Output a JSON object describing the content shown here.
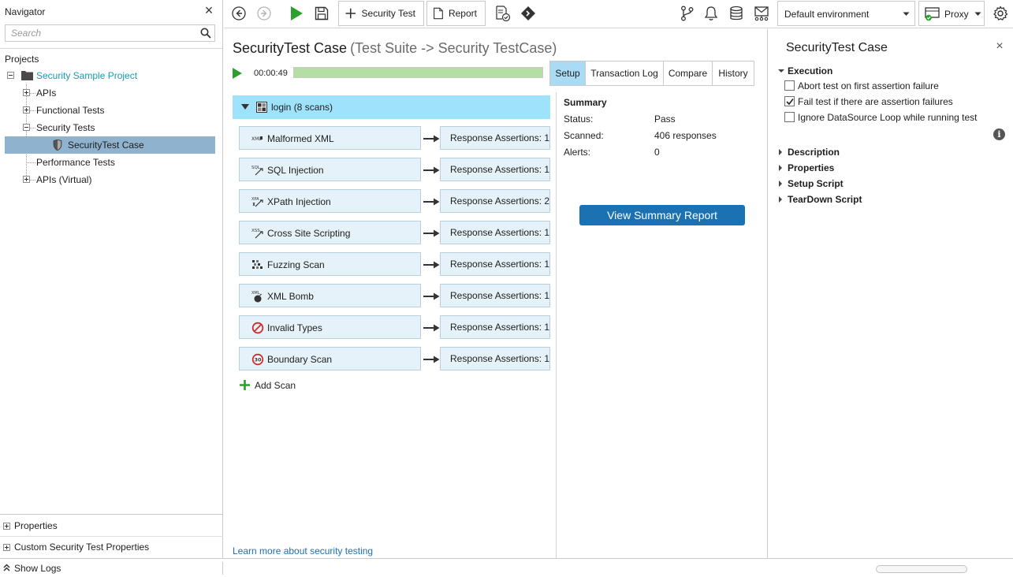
{
  "navigator": {
    "title": "Navigator",
    "search_placeholder": "Search",
    "projects_label": "Projects",
    "tree": [
      {
        "label": "Security Sample Project",
        "level": 0,
        "expanded": true,
        "kind": "project"
      },
      {
        "label": "APIs",
        "level": 1,
        "expanded": false
      },
      {
        "label": "Functional Tests",
        "level": 1,
        "expanded": false
      },
      {
        "label": "Security Tests",
        "level": 1,
        "expanded": true
      },
      {
        "label": "SecurityTest Case",
        "level": 2,
        "selected": true
      },
      {
        "label": "Performance Tests",
        "level": 1
      },
      {
        "label": "APIs (Virtual)",
        "level": 1,
        "expanded": false
      }
    ],
    "bottom": {
      "properties": "Properties",
      "custom_properties": "Custom Security Test Properties"
    }
  },
  "statusbar": {
    "show_logs": "Show Logs"
  },
  "toolbar": {
    "security_test_label": "Security Test",
    "report_label": "Report",
    "environment": "Default environment",
    "proxy_label": "Proxy"
  },
  "main": {
    "title": "SecurityTest Case",
    "subtitle": "(Test Suite -> Security TestCase)",
    "elapsed": "00:00:49",
    "progress": 1.0,
    "tabs": [
      "Setup",
      "Transaction Log",
      "Compare",
      "History"
    ],
    "active_tab": "Setup",
    "group": {
      "label": "login (8 scans)"
    },
    "scans": [
      {
        "name": "Malformed XML",
        "assertion": "Response Assertions: 1",
        "icon": "malformed-xml-icon"
      },
      {
        "name": "SQL Injection",
        "assertion": "Response Assertions: 1",
        "icon": "sql-injection-icon"
      },
      {
        "name": "XPath Injection",
        "assertion": "Response Assertions: 2",
        "icon": "xpath-injection-icon"
      },
      {
        "name": "Cross Site Scripting",
        "assertion": "Response Assertions: 1",
        "icon": "xss-icon"
      },
      {
        "name": "Fuzzing Scan",
        "assertion": "Response Assertions: 1",
        "icon": "fuzzing-icon"
      },
      {
        "name": "XML Bomb",
        "assertion": "Response Assertions: 1",
        "icon": "xml-bomb-icon"
      },
      {
        "name": "Invalid Types",
        "assertion": "Response Assertions: 1",
        "icon": "invalid-types-icon"
      },
      {
        "name": "Boundary Scan",
        "assertion": "Response Assertions: 1",
        "icon": "boundary-scan-icon"
      }
    ],
    "add_scan": "Add Scan",
    "learn_more": "Learn more about security testing",
    "summary": {
      "title": "Summary",
      "rows": [
        {
          "label": "Status:",
          "value": "Pass"
        },
        {
          "label": "Scanned:",
          "value": "406 responses"
        },
        {
          "label": "Alerts:",
          "value": "0"
        }
      ],
      "button": "View Summary Report"
    }
  },
  "right_panel": {
    "title": "SecurityTest Case",
    "execution": {
      "label": "Execution",
      "options": [
        {
          "label": "Abort test on first assertion failure",
          "checked": false
        },
        {
          "label": "Fail test if there are assertion failures",
          "checked": true
        },
        {
          "label": "Ignore DataSource Loop while running test",
          "checked": false
        }
      ]
    },
    "sections": [
      "Description",
      "Properties",
      "Setup Script",
      "TearDown Script"
    ],
    "info_glyph": "i"
  },
  "colors": {
    "accent": "#1a72b3",
    "tab_active": "#a9dbf4",
    "group_bg": "#9ee2fb",
    "scan_bg": "#e5f2f9",
    "progress": "#b4dea4",
    "run_green": "#2ca02c",
    "link": "#1f6fae",
    "project_link": "#1a9bb0"
  }
}
